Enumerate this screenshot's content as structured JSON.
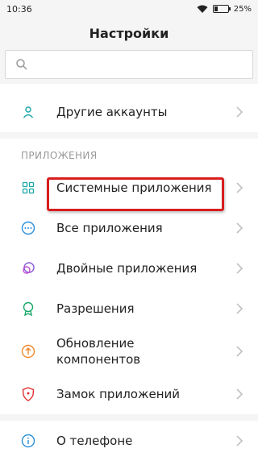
{
  "status": {
    "time": "10:36",
    "battery": "25%",
    "battery_level": 0.25
  },
  "header": {
    "title": "Настройки"
  },
  "search": {
    "placeholder": ""
  },
  "accounts_section": {
    "items": [
      {
        "label": "Другие аккаунты",
        "icon": "person-icon"
      }
    ]
  },
  "apps_section": {
    "title": "ПРИЛОЖЕНИЯ",
    "items": [
      {
        "label": "Системные приложения",
        "icon": "grid-icon",
        "highlighted": true
      },
      {
        "label": "Все приложения",
        "icon": "more-dots-icon"
      },
      {
        "label": "Двойные приложения",
        "icon": "dual-circles-icon"
      },
      {
        "label": "Разрешения",
        "icon": "badge-icon"
      },
      {
        "label": "Обновление компонентов",
        "icon": "upload-icon"
      },
      {
        "label": "Замок приложений",
        "icon": "shield-icon"
      }
    ]
  },
  "about_section": {
    "items": [
      {
        "label": "О телефоне",
        "icon": "info-icon"
      }
    ]
  },
  "colors": {
    "accent": "#1aa6a6",
    "highlight_border": "#d81e1e"
  }
}
